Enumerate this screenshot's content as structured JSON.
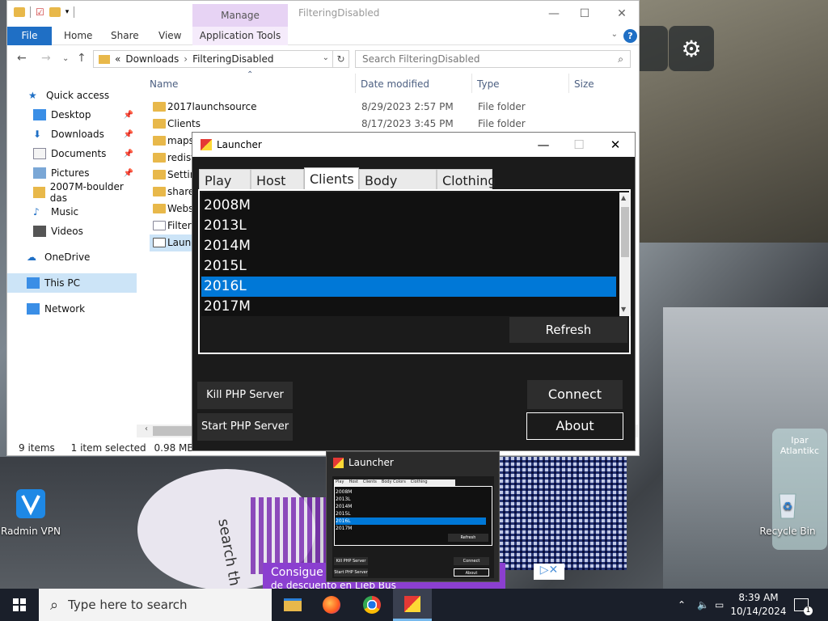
{
  "explorer": {
    "ribbon_context": "Manage",
    "title": "FilteringDisabled",
    "ribbon_tabs": {
      "file": "File",
      "home": "Home",
      "share": "Share",
      "view": "View",
      "app_tools": "Application Tools"
    },
    "address": {
      "prefix": "«",
      "part1": "Downloads",
      "sep": "›",
      "part2": "FilteringDisabled"
    },
    "search_placeholder": "Search FilteringDisabled",
    "nav": [
      {
        "label": "Quick access",
        "icon": "star-icon",
        "pinned": false
      },
      {
        "label": "Desktop",
        "icon": "desktop-icon",
        "pinned": true
      },
      {
        "label": "Downloads",
        "icon": "download-icon",
        "pinned": true
      },
      {
        "label": "Documents",
        "icon": "documents-icon",
        "pinned": true
      },
      {
        "label": "Pictures",
        "icon": "pictures-icon",
        "pinned": true
      },
      {
        "label": "2007M-boulder das",
        "icon": "folder-icon",
        "pinned": false
      },
      {
        "label": "Music",
        "icon": "music-icon",
        "pinned": false
      },
      {
        "label": "Videos",
        "icon": "videos-icon",
        "pinned": false
      },
      {
        "label": "OneDrive",
        "icon": "onedrive-icon",
        "pinned": false
      },
      {
        "label": "This PC",
        "icon": "pc-icon",
        "pinned": false
      },
      {
        "label": "Network",
        "icon": "network-icon",
        "pinned": false
      }
    ],
    "columns": {
      "name": "Name",
      "date": "Date modified",
      "type": "Type",
      "size": "Size"
    },
    "files": [
      {
        "name": "2017launchsource",
        "date": "8/29/2023 2:57 PM",
        "type": "File folder"
      },
      {
        "name": "Clients",
        "date": "8/17/2023 3:45 PM",
        "type": "File folder"
      },
      {
        "name": "maps",
        "date": "",
        "type": ""
      },
      {
        "name": "redist",
        "date": "",
        "type": ""
      },
      {
        "name": "Settin",
        "date": "",
        "type": ""
      },
      {
        "name": "shared",
        "date": "",
        "type": ""
      },
      {
        "name": "Webse",
        "date": "",
        "type": ""
      },
      {
        "name": "Filterin",
        "date": "",
        "type": ""
      },
      {
        "name": "Launc",
        "date": "",
        "type": ""
      }
    ],
    "status": {
      "count": "9 items",
      "selected": "1 item selected",
      "size": "0.98 MB"
    }
  },
  "launcher": {
    "title": "Launcher",
    "tabs": [
      "Play",
      "Host",
      "Clients",
      "Body Colors",
      "Clothing"
    ],
    "active_tab": "Clients",
    "clients": [
      "2008M",
      "2013L",
      "2014M",
      "2015L",
      "2016L",
      "2017M"
    ],
    "selected_client": "2016L",
    "refresh": "Refresh",
    "kill_php": "Kill PHP Server",
    "start_php": "Start PHP Server",
    "connect": "Connect",
    "about": "About"
  },
  "preview": {
    "title": "Launcher",
    "tabs": [
      "Play",
      "Host",
      "Clients",
      "Body Colors",
      "Clothing"
    ],
    "items": [
      "2008M",
      "2013L",
      "2014M",
      "2015L",
      "2016L",
      "2017M"
    ],
    "refresh": "Refresh",
    "kill": "Kill PHP Server",
    "start": "Start PHP Server",
    "connect": "Connect",
    "about": "About"
  },
  "desktop": {
    "radmin": "Radmin VPN",
    "recycle": "Recycle Bin",
    "ad_text": "Consigue",
    "ad_text2": "de descuento en Lieb Bus",
    "side_text": "search th",
    "right_text": "Ipar Atlantikc"
  },
  "taskbar": {
    "search_placeholder": "Type here to search",
    "time": "8:39 AM",
    "date": "10/14/2024",
    "notifications": "1"
  },
  "colors": {
    "accent": "#0078d7",
    "file_tab": "#1f6fc5",
    "manage_tab": "#e7d3f4"
  }
}
